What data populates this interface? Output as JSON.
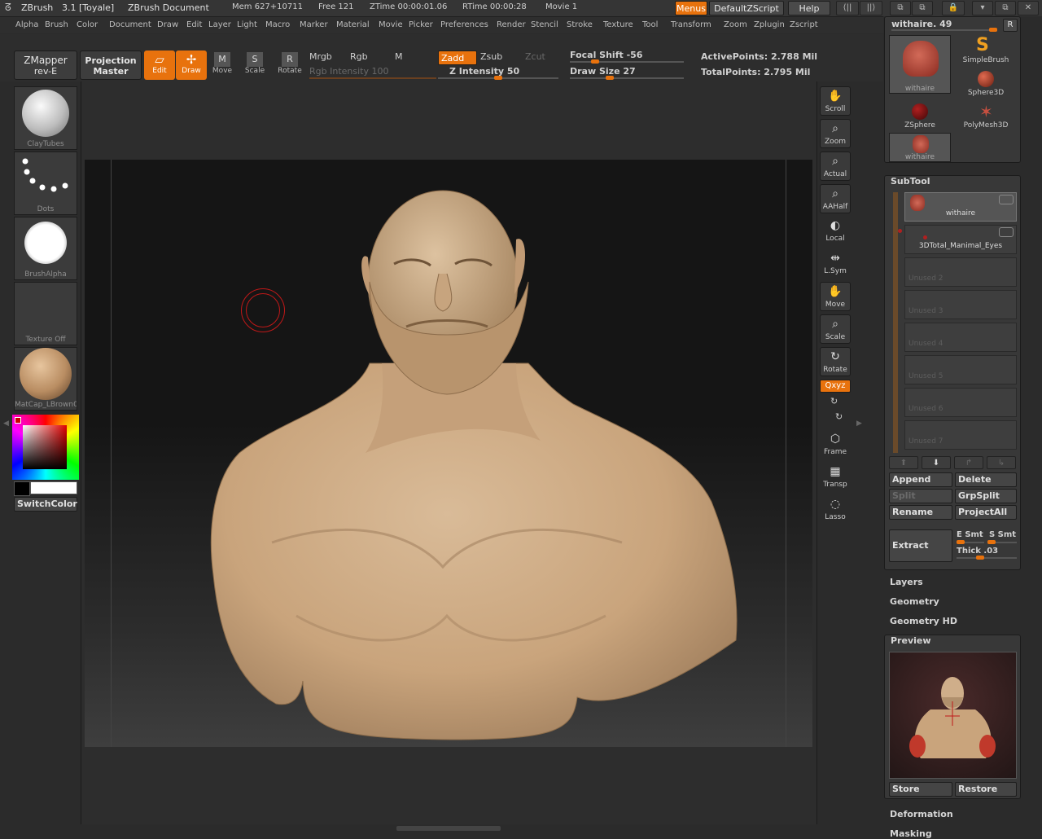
{
  "titlebar": {
    "app": "ZBrush",
    "version": "3.1 [Toyale]",
    "document": "ZBrush Document",
    "mem": "Mem 627+10711",
    "free": "Free 121",
    "ztime": "ZTime 00:00:01.06",
    "rtime": "RTime 00:00:28",
    "movie": "Movie 1",
    "menus_btn": "Menus",
    "script_btn": "DefaultZScript",
    "help_btn": "Help"
  },
  "menubar": {
    "items": [
      "Alpha",
      "Brush",
      "Color",
      "Document",
      "Draw",
      "Edit",
      "Layer",
      "Light",
      "Macro",
      "Marker",
      "Material",
      "Movie",
      "Picker",
      "Preferences",
      "Render",
      "Stencil",
      "Stroke",
      "Texture",
      "Tool",
      "Transform",
      "Zoom",
      "Zplugin",
      "Zscript"
    ]
  },
  "toolbar": {
    "zmapper": "ZMapper",
    "zmapper_sub": "rev-E",
    "projection": "Projection",
    "projection_sub": "Master",
    "tools": [
      {
        "label": "Edit",
        "icon": "edit-icon",
        "glyph": "▱",
        "active": true
      },
      {
        "label": "Draw",
        "icon": "draw-icon",
        "glyph": "✢",
        "active": true
      },
      {
        "label": "Move",
        "icon": "move-icon",
        "glyph": "M",
        "active": false
      },
      {
        "label": "Scale",
        "icon": "scale-icon",
        "glyph": "S",
        "active": false
      },
      {
        "label": "Rotate",
        "icon": "rotate-icon",
        "glyph": "R",
        "active": false
      }
    ],
    "mrgb": "Mrgb",
    "rgb": "Rgb",
    "m": "M",
    "rgb_intensity": "Rgb Intensity 100",
    "rgb_intensity_value": 100,
    "zadd": "Zadd",
    "zsub": "Zsub",
    "zcut": "Zcut",
    "z_intensity": "Z Intensity 50",
    "z_intensity_value": 50,
    "focal_shift": "Focal Shift -56",
    "focal_shift_value": -56,
    "draw_size": "Draw Size 27",
    "draw_size_value": 27,
    "active_points": "ActivePoints: 2.788 Mil",
    "total_points": "TotalPoints: 2.795 Mil"
  },
  "left_shelf": {
    "brush": "ClayTubes",
    "stroke": "Dots",
    "alpha": "BrushAlpha",
    "texture": "Texture Off",
    "material": "MatCap_LBrown0",
    "switch_color": "SwitchColor"
  },
  "right_shelf": {
    "tools": [
      {
        "label": "Scroll",
        "icon": "scroll-icon",
        "glyph": "✋"
      },
      {
        "label": "Zoom",
        "icon": "zoom-icon",
        "glyph": "⌕"
      },
      {
        "label": "Actual",
        "icon": "actual-icon",
        "glyph": "⌕"
      },
      {
        "label": "AAHalf",
        "icon": "aahalf-icon",
        "glyph": "⌕"
      },
      {
        "label": "Local",
        "icon": "local-icon",
        "glyph": "◐"
      },
      {
        "label": "L.Sym",
        "icon": "lsym-icon",
        "glyph": "⇹"
      },
      {
        "label": "Move",
        "icon": "move-icon",
        "glyph": "✋"
      },
      {
        "label": "Scale",
        "icon": "scale-icon",
        "glyph": "⌕"
      },
      {
        "label": "Rotate",
        "icon": "rotate-icon",
        "glyph": "↻"
      }
    ],
    "xyz": "Qxyz",
    "frame": "Frame",
    "transp": "Transp",
    "lasso": "Lasso"
  },
  "tool_panel": {
    "current": "withaire. 49",
    "r_button": "R",
    "items": [
      "withaire",
      "SimpleBrush",
      "Sphere3D",
      "ZSphere",
      "PolyMesh3D",
      "withaire"
    ]
  },
  "subtool": {
    "title": "SubTool",
    "rows": [
      {
        "name": "withaire",
        "active": true
      },
      {
        "name": "3DTotal_Manimal_Eyes",
        "active": true
      },
      {
        "name": "Unused 2",
        "active": false
      },
      {
        "name": "Unused 3",
        "active": false
      },
      {
        "name": "Unused 4",
        "active": false
      },
      {
        "name": "Unused 5",
        "active": false
      },
      {
        "name": "Unused 6",
        "active": false
      },
      {
        "name": "Unused 7",
        "active": false
      }
    ],
    "append": "Append",
    "delete": "Delete",
    "split": "Split",
    "grpsplit": "GrpSplit",
    "rename": "Rename",
    "projectall": "ProjectAll",
    "extract": "Extract",
    "e_smt": "E Smt",
    "s_smt": "S Smt",
    "thick": "Thick .03"
  },
  "sections": {
    "layers": "Layers",
    "geometry": "Geometry",
    "geometry_hd": "Geometry HD",
    "preview": "Preview",
    "store": "Store",
    "restore": "Restore",
    "deformation": "Deformation",
    "masking": "Masking"
  },
  "colors": {
    "accent": "#e8720d",
    "skin": "#cfae8a",
    "red_cursor": "#c01818"
  }
}
